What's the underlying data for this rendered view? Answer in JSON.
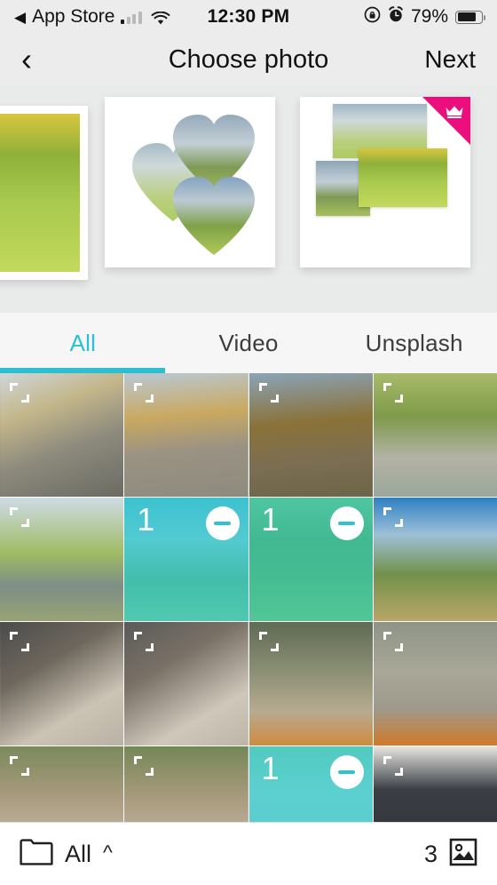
{
  "status_bar": {
    "back_app": "App Store",
    "back_arrow": "◀",
    "time": "12:30 PM",
    "battery_percent": "79%",
    "icons": [
      "signal-bars-icon",
      "wifi-icon",
      "rotation-lock-icon",
      "alarm-icon",
      "battery-icon"
    ]
  },
  "nav_bar": {
    "back": "‹",
    "title": "Choose photo",
    "next": "Next"
  },
  "templates": {
    "items": [
      {
        "name": "single-photo-template",
        "premium": false
      },
      {
        "name": "three-hearts-template",
        "premium": false
      },
      {
        "name": "three-photo-collage-template",
        "premium": true
      }
    ],
    "premium_badge_color": "#ec0e7c",
    "premium_badge_icon": "crown-icon"
  },
  "tabs": {
    "items": [
      {
        "label": "All",
        "active": true
      },
      {
        "label": "Video",
        "active": false
      },
      {
        "label": "Unsplash",
        "active": false
      }
    ],
    "active_color": "#29c2d4",
    "indicator_color": "#2dbfd0"
  },
  "grid": {
    "selection_overlay_color": "#29c7cd",
    "expand_icon": "expand-icon",
    "remove_icon": "minus-circle-icon",
    "cells": [
      {
        "art": "t-bridgedog",
        "selected": false,
        "badge": ""
      },
      {
        "art": "t-dam1",
        "selected": false,
        "badge": ""
      },
      {
        "art": "t-dam2",
        "selected": false,
        "badge": ""
      },
      {
        "art": "t-rocks",
        "selected": false,
        "badge": ""
      },
      {
        "art": "t-road",
        "selected": false,
        "badge": ""
      },
      {
        "art": "t-valley",
        "selected": true,
        "badge": "1",
        "tone": "cool"
      },
      {
        "art": "t-silo",
        "selected": true,
        "badge": "1",
        "tone": "warm"
      },
      {
        "art": "t-cabin",
        "selected": false,
        "badge": ""
      },
      {
        "art": "t-tent1",
        "selected": false,
        "badge": ""
      },
      {
        "art": "t-tent2",
        "selected": false,
        "badge": ""
      },
      {
        "art": "t-fire1",
        "selected": false,
        "badge": ""
      },
      {
        "art": "t-fire2",
        "selected": false,
        "badge": ""
      },
      {
        "art": "t-sit1",
        "selected": false,
        "badge": ""
      },
      {
        "art": "t-sit2",
        "selected": false,
        "badge": ""
      },
      {
        "art": "t-white",
        "selected": true,
        "badge": "1",
        "tone": "cool"
      },
      {
        "art": "t-darkhouse",
        "selected": false,
        "badge": ""
      }
    ]
  },
  "bottom_bar": {
    "folder_icon": "folder-icon",
    "folder_label": "All",
    "caret_icon": "chevron-up-icon",
    "selected_count": "3",
    "photos_icon": "image-icon"
  }
}
